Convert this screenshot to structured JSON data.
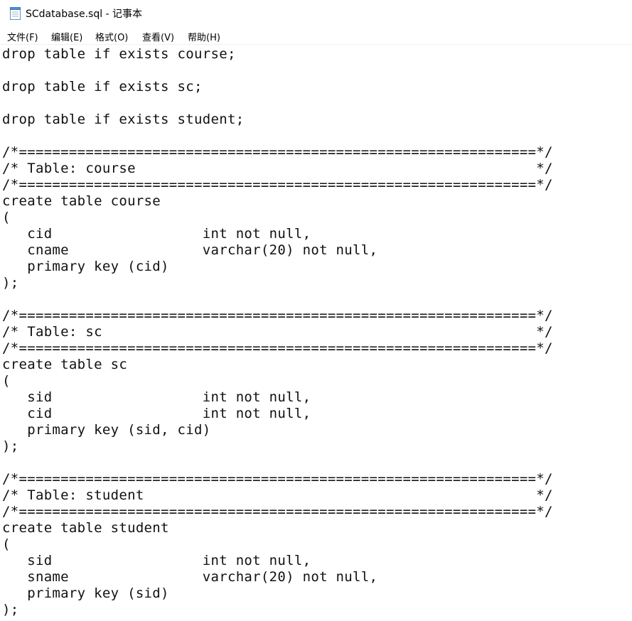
{
  "window": {
    "title": "SCdatabase.sql - 记事本",
    "icon": "notepad-icon"
  },
  "menu": [
    {
      "label": "文件(F)"
    },
    {
      "label": "编辑(E)"
    },
    {
      "label": "格式(O)"
    },
    {
      "label": "查看(V)"
    },
    {
      "label": "帮助(H)"
    }
  ],
  "editor": {
    "content": "drop table if exists course;\n\ndrop table if exists sc;\n\ndrop table if exists student;\n\n/*==============================================================*/\n/* Table: course                                                */\n/*==============================================================*/\ncreate table course\n(\n   cid                  int not null,\n   cname                varchar(20) not null,\n   primary key (cid)\n);\n\n/*==============================================================*/\n/* Table: sc                                                    */\n/*==============================================================*/\ncreate table sc\n(\n   sid                  int not null,\n   cid                  int not null,\n   primary key (sid, cid)\n);\n\n/*==============================================================*/\n/* Table: student                                               */\n/*==============================================================*/\ncreate table student\n(\n   sid                  int not null,\n   sname                varchar(20) not null,\n   primary key (sid)\n);"
  }
}
